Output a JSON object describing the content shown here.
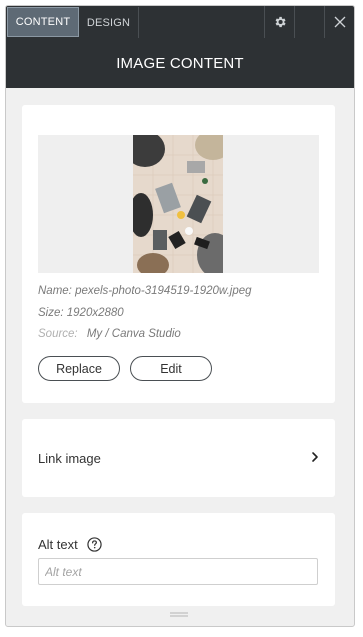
{
  "tabs": {
    "content": "CONTENT",
    "design": "DESIGN"
  },
  "icons": {
    "settings": "gear-icon",
    "close": "close-icon",
    "chevron": "chevron-right-icon",
    "help": "question-circle-icon",
    "grip": "drag-handle-icon"
  },
  "header": {
    "title": "IMAGE CONTENT"
  },
  "image": {
    "name_line": "Name: pexels-photo-3194519-1920w.jpeg",
    "size_line": "Size: 1920x2880",
    "source_label": "Source:",
    "source_value": "My / Canva Studio",
    "replace_label": "Replace",
    "edit_label": "Edit"
  },
  "link": {
    "label": "Link image"
  },
  "alt": {
    "label": "Alt text",
    "placeholder": "Alt text",
    "value": ""
  },
  "colors": {
    "topbar": "#2d3134",
    "active_tab": "#5e6a75",
    "panel_bg": "#f0f0f0",
    "card_bg": "#ffffff"
  }
}
